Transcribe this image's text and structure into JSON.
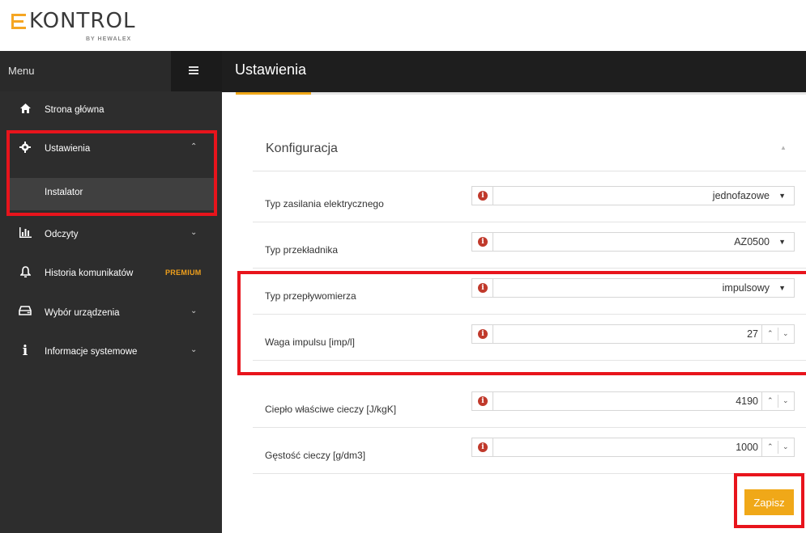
{
  "logo": {
    "brand": "KONTROL",
    "sub": "BY HEWALEX",
    "accent_color": "#f5a623"
  },
  "sidebar": {
    "menu_label": "Menu",
    "items": [
      {
        "label": "Strona główna",
        "icon": "home-icon"
      },
      {
        "label": "Ustawienia",
        "icon": "gear-icon"
      },
      {
        "label": "Instalator"
      },
      {
        "label": "Odczyty",
        "icon": "bar-chart-icon"
      },
      {
        "label": "Historia komunikatów",
        "icon": "bell-icon",
        "badge": "PREMIUM"
      },
      {
        "label": "Wybór urządzenia",
        "icon": "device-icon"
      },
      {
        "label": "Informacje systemowe",
        "icon": "info-icon"
      }
    ]
  },
  "header": {
    "title": "Ustawienia"
  },
  "config": {
    "section_title": "Konfiguracja",
    "rows": [
      {
        "label": "Typ zasilania elektrycznego",
        "value": "jednofazowe",
        "type": "select"
      },
      {
        "label": "Typ przekładnika",
        "value": "AZ0500",
        "type": "select"
      },
      {
        "label": "Typ przepływomierza",
        "value": "impulsowy",
        "type": "select"
      },
      {
        "label": "Waga impulsu [imp/l]",
        "value": "27",
        "type": "number"
      },
      {
        "label": "Ciepło właściwe cieczy [J/kgK]",
        "value": "4190",
        "type": "number"
      },
      {
        "label": "Gęstość cieczy [g/dm3]",
        "value": "1000",
        "type": "number"
      }
    ],
    "save_label": "Zapisz"
  },
  "colors": {
    "accent": "#f0a818",
    "highlight": "#e8141c",
    "sidebar_bg": "#2d2d2d",
    "info_icon": "#c0392b"
  }
}
